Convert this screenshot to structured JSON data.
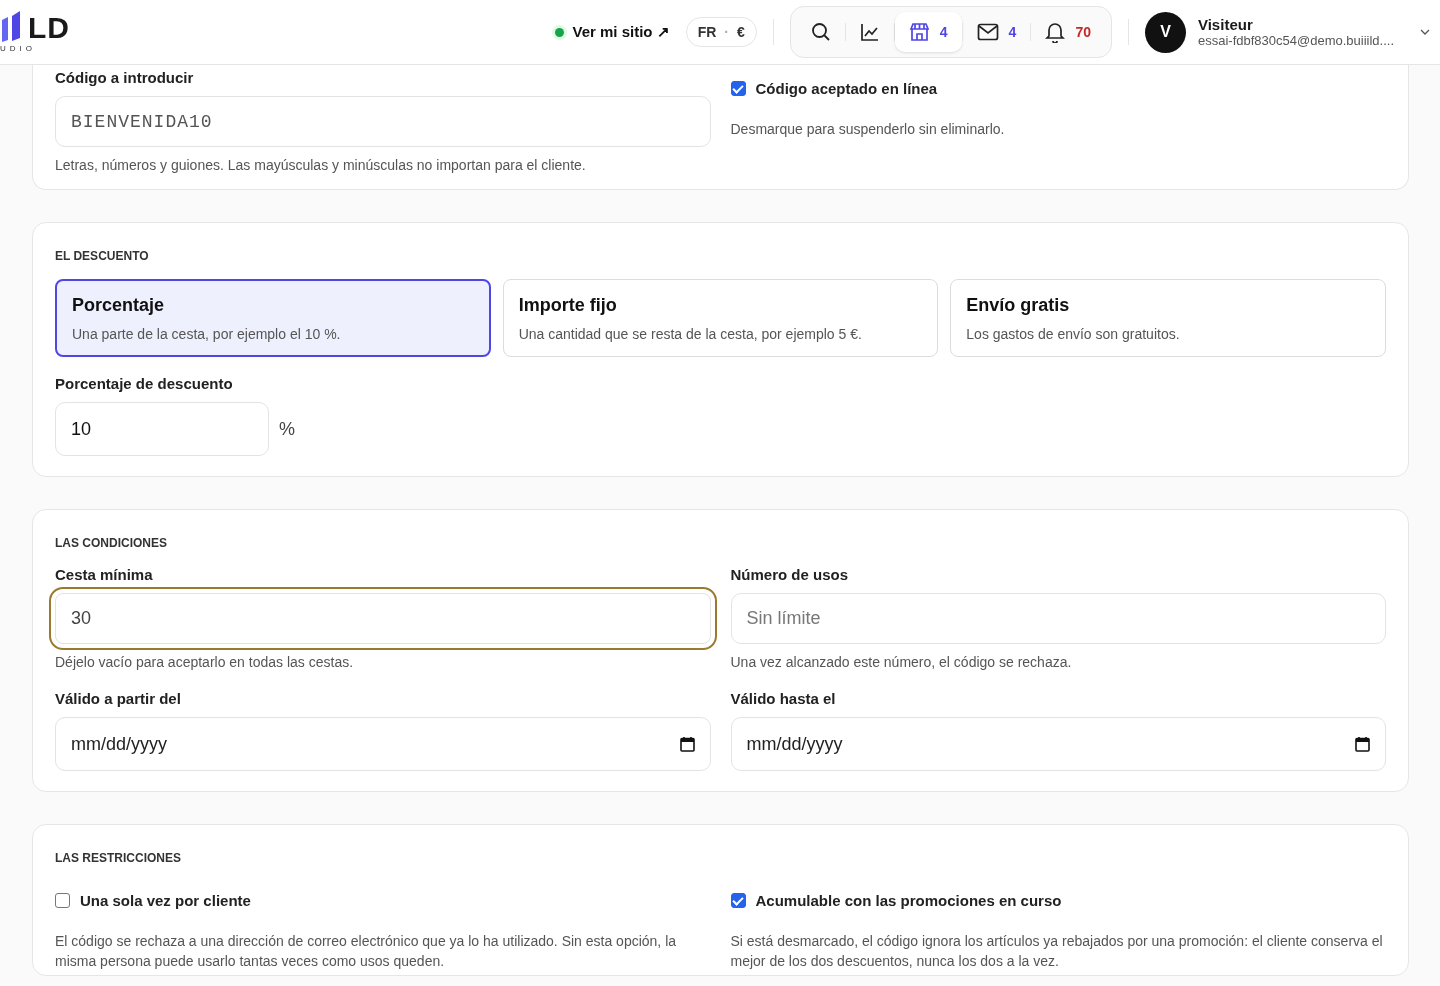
{
  "header": {
    "logo": {
      "mark": "LD",
      "tagline": "UDIO"
    },
    "site_link": {
      "label": "Ver mi sitio ↗",
      "online": true
    },
    "locale": {
      "language": "FR",
      "separator": "·",
      "currency": "€"
    },
    "toolbar": [
      {
        "kind": "search",
        "selected": false
      },
      {
        "kind": "chart",
        "selected": false
      },
      {
        "kind": "store",
        "count": "4",
        "selected": true
      },
      {
        "kind": "mail",
        "count": "4",
        "selected": false
      },
      {
        "kind": "bell",
        "count": "70",
        "selected": false
      }
    ],
    "user": {
      "initial": "V",
      "name": "Visiteur",
      "email": "essai-fdbf830c54@demo.buiiild...."
    }
  },
  "sections": [
    {
      "items": [
        {
          "kind": "code_field",
          "label": "Código a introducir",
          "value": "BIENVENIDA10",
          "help": "Letras, números y guiones. Las mayúsculas y minúsculas no importan para el cliente."
        },
        {
          "kind": "checkbox",
          "label": "Código aceptado en línea",
          "checked": true,
          "help": "Desmarque para suspenderlo sin eliminarlo."
        }
      ]
    },
    {
      "title": "EL DESCUENTO",
      "items": [
        {
          "kind": "choices",
          "options": [
            {
              "title": "Porcentaje",
              "description": "Una parte de la cesta, por ejemplo el 10 %.",
              "selected": true
            },
            {
              "title": "Importe fijo",
              "description": "Una cantidad que se resta de la cesta, por ejemplo 5 €.",
              "selected": false
            },
            {
              "title": "Envío gratis",
              "description": "Los gastos de envío son gratuitos.",
              "selected": false
            }
          ]
        },
        {
          "kind": "unit_field",
          "label": "Porcentaje de descuento",
          "value": "10",
          "unit": "%"
        }
      ]
    },
    {
      "title": "LAS CONDICIONES",
      "items": [
        {
          "kind": "text_field",
          "label": "Cesta mínima",
          "value": "30",
          "focused": true,
          "help": "Déjelo vacío para aceptarlo en todas las cestas."
        },
        {
          "kind": "text_field",
          "label": "Número de usos",
          "placeholder": "Sin límite",
          "focused": false,
          "help": "Una vez alcanzado este número, el código se rechaza."
        },
        {
          "kind": "date_field",
          "label": "Válido a partir del",
          "format": "mm/dd/yyyy"
        },
        {
          "kind": "date_field",
          "label": "Válido hasta el",
          "format": "mm/dd/yyyy"
        }
      ]
    },
    {
      "title": "LAS RESTRICCIONES",
      "items": [
        {
          "kind": "checkbox",
          "label": "Una sola vez por cliente",
          "checked": false,
          "help": "El código se rechaza a una dirección de correo electrónico que ya lo ha utilizado. Sin esta opción, la misma persona puede usarlo tantas veces como usos queden."
        },
        {
          "kind": "checkbox",
          "label": "Acumulable con las promociones en curso",
          "checked": true,
          "help": "Si está desmarcado, el código ignora los artículos ya rebajados por una promoción: el cliente conserva el mejor de los dos descuentos, nunca los dos a la vez."
        }
      ]
    }
  ]
}
